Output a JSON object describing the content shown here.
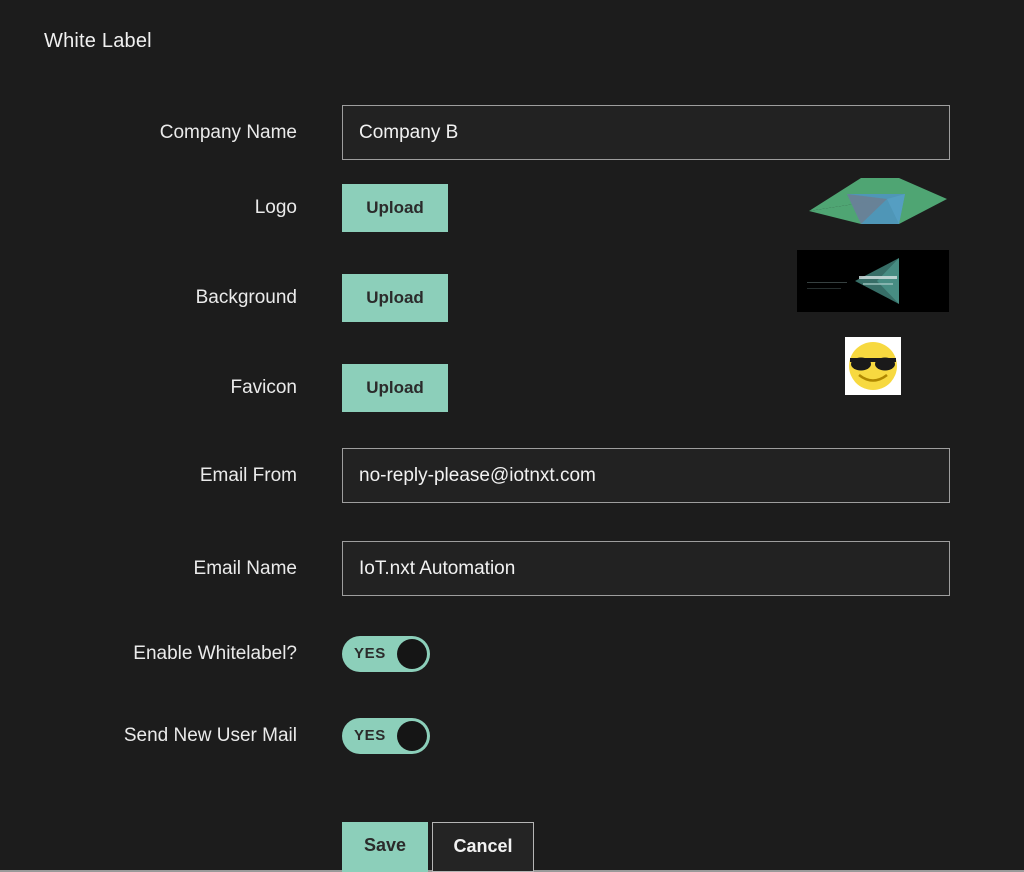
{
  "page": {
    "title": "White Label",
    "background_color": "#1c1c1c",
    "accent_color": "#8ccfba",
    "text_color": "#eaeaea"
  },
  "form": {
    "rows": [
      {
        "id": "company-name",
        "label": "Company Name",
        "type": "text",
        "value": "Company B",
        "placeholder": "Company Name"
      },
      {
        "id": "logo",
        "label": "Logo",
        "type": "upload",
        "button_label": "Upload",
        "preview_alt": "logo-preview"
      },
      {
        "id": "background",
        "label": "Background",
        "type": "upload",
        "button_label": "Upload",
        "preview_alt": "background-preview"
      },
      {
        "id": "favicon",
        "label": "Favicon",
        "type": "upload",
        "button_label": "Upload",
        "preview_alt": "favicon-preview"
      },
      {
        "id": "email-from",
        "label": "Email From",
        "type": "text",
        "value": "no-reply-please@iotnxt.com",
        "placeholder": "Email From"
      },
      {
        "id": "email-name",
        "label": "Email Name",
        "type": "text",
        "value": "IoT.nxt Automation",
        "placeholder": "Email Name"
      },
      {
        "id": "enable-whitelabel",
        "label": "Enable Whitelabel?",
        "type": "toggle",
        "state_label": "YES",
        "checked": true
      },
      {
        "id": "send-new-user-mail",
        "label": "Send New User Mail",
        "type": "toggle",
        "state_label": "YES",
        "checked": true
      }
    ]
  },
  "actions": {
    "save_label": "Save",
    "cancel_label": "Cancel"
  }
}
